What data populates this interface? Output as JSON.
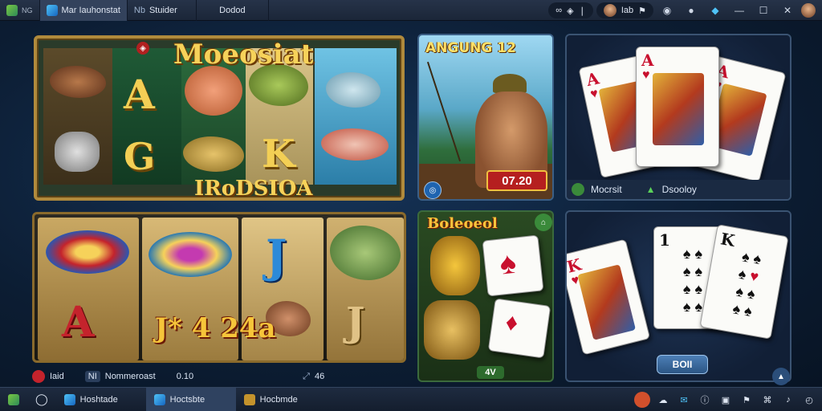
{
  "window": {
    "tabs": [
      {
        "label": "Mar Iauhonstat"
      },
      {
        "label": "Stuider",
        "prefix": "Nb"
      },
      {
        "label": "Dodod"
      }
    ],
    "search_text": "∞",
    "user_name": "Iab"
  },
  "games": {
    "fish_slot": {
      "title": "Moeosiat",
      "subtitle": "IRoDSIOA",
      "letters": [
        "A",
        "G",
        "K"
      ]
    },
    "fisherman": {
      "title": "ANGUNG 12",
      "score": "07.20"
    },
    "card_top": {
      "left_label": "Mocrsit",
      "right_label": "Dsooloy"
    },
    "letter_slot": {
      "big_text": "J* 4 24a",
      "letters": [
        "A",
        "J",
        "J"
      ],
      "info_left": "Iaid",
      "info_mid": "Nommeroast",
      "info_value": "0.10",
      "info_right": "46"
    },
    "card_mid": {
      "title": "Boleoeol",
      "badge": "4V"
    },
    "card_bottom": {
      "button_label": "BOII"
    }
  },
  "taskbar": {
    "items": [
      {
        "label": "Hoshtade"
      },
      {
        "label": "Hoctsbte"
      },
      {
        "label": "Hocbmde"
      }
    ],
    "tray_icons": [
      "shield-icon",
      "cloud-icon",
      "chat-icon",
      "info-icon",
      "window-icon",
      "flag-icon",
      "network-icon",
      "volume-icon",
      "clock-icon"
    ]
  }
}
